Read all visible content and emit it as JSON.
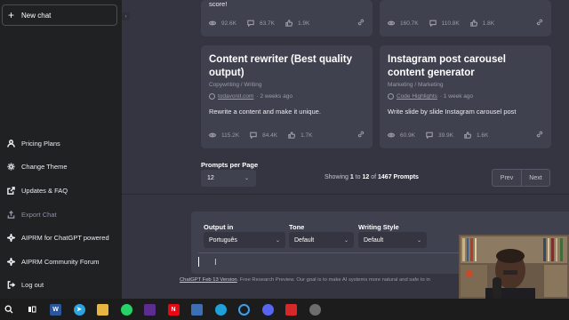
{
  "sidebar": {
    "new_chat": "New chat",
    "items": [
      {
        "label": "Pricing Plans",
        "icon": "person-icon",
        "disabled": false
      },
      {
        "label": "Change Theme",
        "icon": "sun-icon",
        "disabled": false
      },
      {
        "label": "Updates & FAQ",
        "icon": "external-link-icon",
        "disabled": false
      },
      {
        "label": "Export Chat",
        "icon": "export-icon",
        "disabled": true
      },
      {
        "label": "AIPRM for ChatGPT powered",
        "icon": "sparkle-icon",
        "disabled": false
      },
      {
        "label": "AIPRM Community Forum",
        "icon": "sparkle-icon",
        "disabled": false
      },
      {
        "label": "Log out",
        "icon": "logout-icon",
        "disabled": false
      }
    ]
  },
  "cards": [
    {
      "title": "",
      "desc": "score!",
      "stats": {
        "views": "92.6K",
        "comments": "63.7K",
        "likes": "1.9K"
      }
    },
    {
      "title": "",
      "desc": "",
      "stats": {
        "views": "160.7K",
        "comments": "110.8K",
        "likes": "1.8K"
      }
    },
    {
      "title": "Content rewriter (Best quality output)",
      "category": "Copywriting / Writing",
      "author": "todavonit.com",
      "age": "· 2 weeks ago",
      "desc": "Rewrite a content and make it unique.",
      "stats": {
        "views": "115.2K",
        "comments": "84.4K",
        "likes": "1.7K"
      }
    },
    {
      "title": "Instagram post carousel content generator",
      "category": "Marketing / Marketing",
      "author": "Code Highlights",
      "age": "· 1 week ago",
      "desc": "Write slide by slide Instagram carousel post",
      "stats": {
        "views": "60.9K",
        "comments": "39.9K",
        "likes": "1.6K"
      }
    }
  ],
  "pagination": {
    "per_page_label": "Prompts per Page",
    "per_page_value": "12",
    "showing_prefix": "Showing",
    "from": "1",
    "to_word": "to",
    "to": "12",
    "of_word": "of",
    "total": "1467 Prompts",
    "prev": "Prev",
    "next": "Next"
  },
  "form": {
    "output_label": "Output in",
    "output_value": "Português",
    "tone_label": "Tone",
    "tone_value": "Default",
    "style_label": "Writing Style",
    "style_value": "Default"
  },
  "footer": {
    "link": "ChatGPT Feb 13 Version",
    "text": ". Free Research Preview. Our goal is to make AI systems more natural and safe to in"
  },
  "taskbar": [
    {
      "name": "search-icon",
      "color": "#1c1c1c"
    },
    {
      "name": "task-view-icon",
      "color": "#1c1c1c"
    },
    {
      "name": "word-icon",
      "color": "#2b579a"
    },
    {
      "name": "telegram-icon",
      "color": "#2aa3de"
    },
    {
      "name": "file-explorer-icon",
      "color": "#e8b640"
    },
    {
      "name": "whatsapp-icon",
      "color": "#25d366"
    },
    {
      "name": "app-icon",
      "color": "#5c2d91"
    },
    {
      "name": "netflix-icon",
      "color": "#e50914"
    },
    {
      "name": "app-icon",
      "color": "#3d6fb5"
    },
    {
      "name": "edge-icon",
      "color": "#1fa0d8"
    },
    {
      "name": "cortana-icon",
      "color": "#3aa0f0"
    },
    {
      "name": "discord-icon",
      "color": "#5865f2"
    },
    {
      "name": "app-icon",
      "color": "#d62828"
    },
    {
      "name": "app-icon",
      "color": "#6d6d6d"
    }
  ]
}
